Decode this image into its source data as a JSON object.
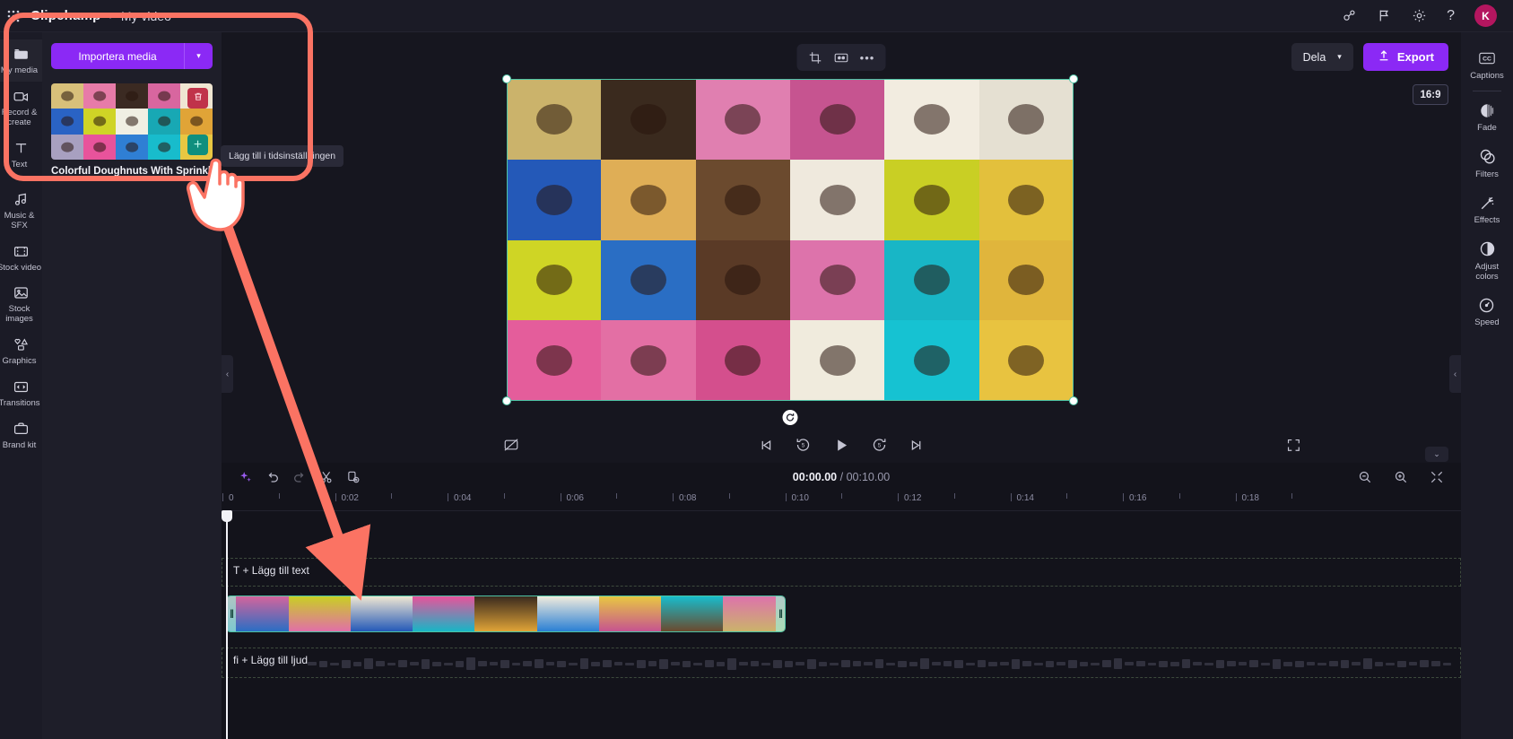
{
  "header": {
    "grid_icon": "waffle-grid-icon",
    "brand": "Clipchamp",
    "separator": "›",
    "project_title": "My video",
    "caret": "▾",
    "icons": [
      {
        "name": "share-connect-icon",
        "glyph": "share"
      },
      {
        "name": "flag-feedback-icon",
        "glyph": "flag"
      },
      {
        "name": "settings-gear-icon",
        "glyph": "gear"
      },
      {
        "name": "help-icon",
        "glyph": "?"
      }
    ],
    "avatar_initial": "K",
    "avatar_color": "#b4165f"
  },
  "sidebar": {
    "items": [
      {
        "label": "My media",
        "icon": "folder-icon",
        "active": true
      },
      {
        "label": "Record &\ncreate",
        "icon": "camera-icon",
        "active": false
      },
      {
        "label": "Text",
        "icon": "text-t-icon",
        "active": false
      },
      {
        "label": "Music & SFX",
        "icon": "music-note-icon",
        "active": false
      },
      {
        "label": "Stock video",
        "icon": "film-strip-icon",
        "active": false
      },
      {
        "label": "Stock\nimages",
        "icon": "image-icon",
        "active": false
      },
      {
        "label": "Graphics",
        "icon": "shapes-icon",
        "active": false
      },
      {
        "label": "Transitions",
        "icon": "transition-icon",
        "active": false
      },
      {
        "label": "Brand kit",
        "icon": "brand-kit-icon",
        "active": false
      }
    ]
  },
  "media_panel": {
    "import_label": "Importera media",
    "import_caret": "▾",
    "import_color": "#8b29f5",
    "item": {
      "name": "Colorful Doughnuts With Sprinkles",
      "delete_icon": "trash-icon",
      "delete_color": "#c0334a",
      "add_icon": "plus-icon",
      "add_color": "#0f8f7e",
      "add_glyph": "+"
    },
    "tooltip": "Lägg till i tidsinställningen"
  },
  "preview": {
    "toolbar": [
      {
        "name": "crop-icon",
        "glyph": "crop"
      },
      {
        "name": "fit-fill-icon",
        "glyph": "fit"
      },
      {
        "name": "more-options-icon",
        "glyph": "•••"
      }
    ],
    "share_label": "Dela",
    "share_caret": "▾",
    "export_label": "Export",
    "export_icon": "upload-icon",
    "aspect_ratio": "16:9",
    "selection_color": "#4dc3a5",
    "rotate_icon": "rotate-handle-icon",
    "controls": [
      {
        "name": "captions-off-icon",
        "glyph": "cc-off"
      },
      {
        "name": "skip-to-start-icon",
        "glyph": "skip-back"
      },
      {
        "name": "rewind-5s-icon",
        "glyph": "back5"
      },
      {
        "name": "play-icon",
        "glyph": "play"
      },
      {
        "name": "forward-5s-icon",
        "glyph": "fwd5"
      },
      {
        "name": "skip-to-end-icon",
        "glyph": "skip-fwd"
      },
      {
        "name": "fullscreen-icon",
        "glyph": "fullscreen"
      }
    ],
    "collapse_left": "‹",
    "collapse_right": "‹"
  },
  "properties": {
    "items": [
      {
        "label": "Captions",
        "icon": "closed-captions-icon"
      },
      {
        "label": "Fade",
        "icon": "fade-icon"
      },
      {
        "label": "Filters",
        "icon": "filters-icon"
      },
      {
        "label": "Effects",
        "icon": "effects-wand-icon"
      },
      {
        "label": "Adjust\ncolors",
        "icon": "adjust-colors-icon"
      },
      {
        "label": "Speed",
        "icon": "speed-gauge-icon"
      }
    ]
  },
  "timeline": {
    "tools": [
      {
        "name": "ai-sparkle-icon",
        "glyph": "sparkle"
      },
      {
        "name": "undo-icon",
        "glyph": "undo"
      },
      {
        "name": "redo-icon",
        "glyph": "redo"
      },
      {
        "name": "split-scissors-icon",
        "glyph": "scissors"
      },
      {
        "name": "duplicate-icon",
        "glyph": "duplicate"
      }
    ],
    "current_time": "00:00.00",
    "time_separator": "/",
    "total_time": "00:10.00",
    "right_tools": [
      {
        "name": "zoom-out-icon",
        "glyph": "zoom-out"
      },
      {
        "name": "zoom-in-icon",
        "glyph": "zoom-in"
      },
      {
        "name": "fit-timeline-icon",
        "glyph": "fit"
      }
    ],
    "collapse_icon": "chevron-down-icon",
    "collapse_glyph": "⌄",
    "ruler_ticks": [
      "0",
      "0:02",
      "0:04",
      "0:06",
      "0:08",
      "0:10",
      "0:12",
      "0:14",
      "0:16",
      "0:18"
    ],
    "text_track_label": "T + Lägg till text",
    "audio_track_label": "fi + Lägg till ljud",
    "clip_color": "#4dc3a5"
  },
  "annotations": {
    "highlight_color": "#fb7363",
    "arrow_name": "red-arrow-annotation",
    "rect_name": "red-highlight-rectangle",
    "cursor_name": "hand-cursor-annotation"
  }
}
